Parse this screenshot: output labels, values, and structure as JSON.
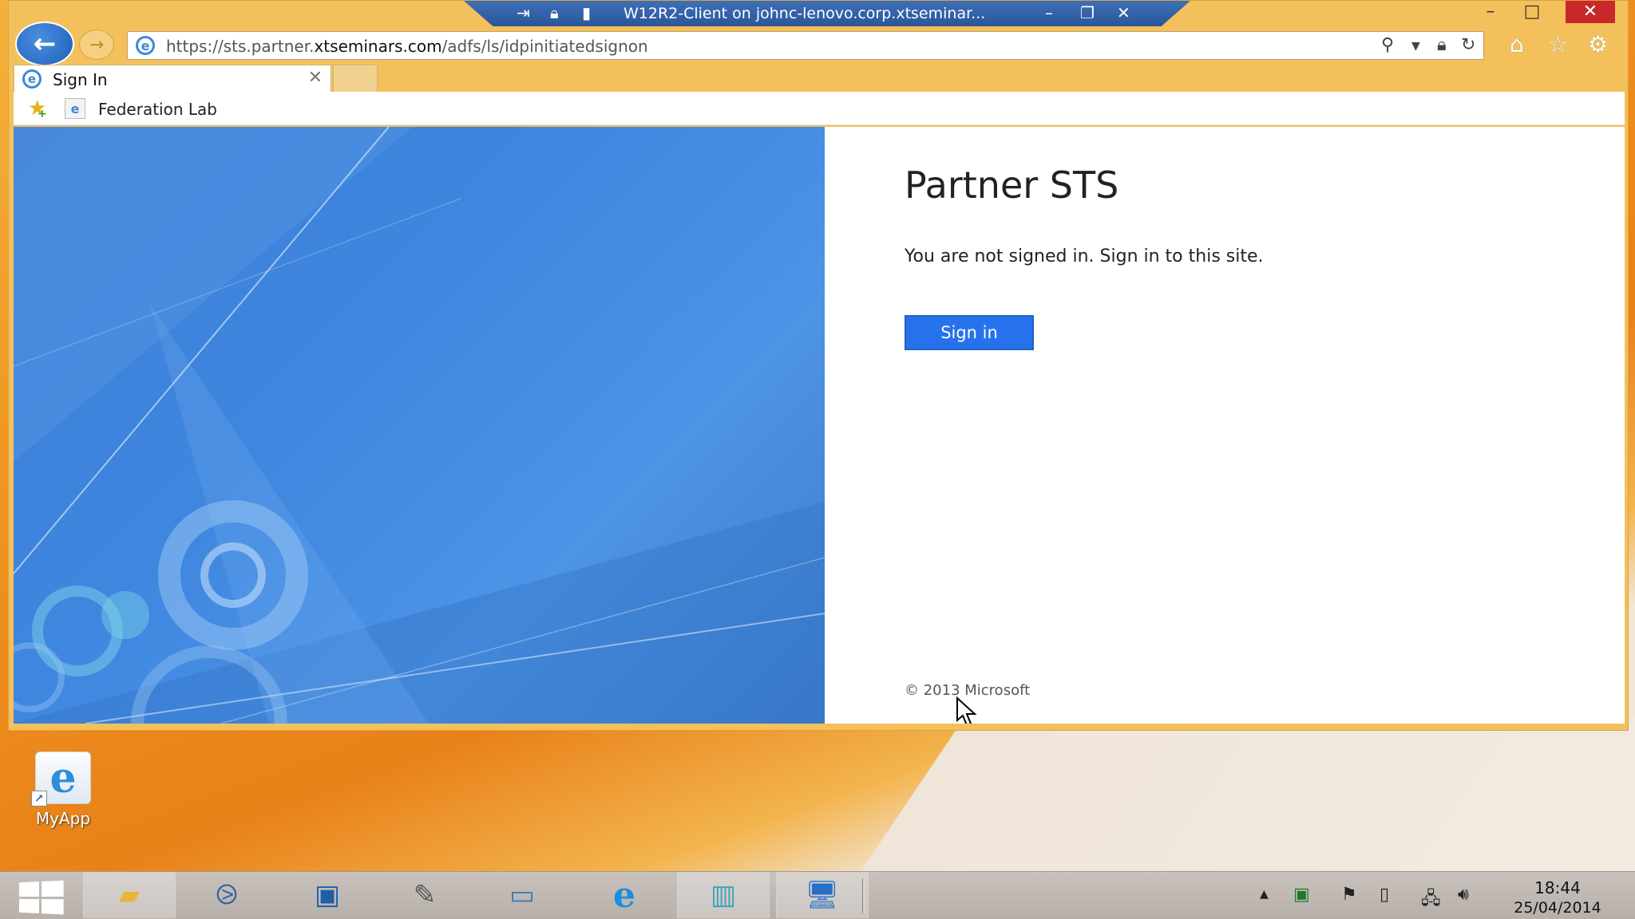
{
  "remote_session": {
    "title": "W12R2-Client on johnc-lenovo.corp.xtseminar...",
    "icons": {
      "pin": "pin-icon",
      "lock": "lock-icon",
      "signal": "signal-strength-icon",
      "minimize": "minimize-icon",
      "restore": "restore-icon",
      "close": "close-icon"
    }
  },
  "window_controls": {
    "minimize": "–",
    "maximize": "□",
    "close": "✕"
  },
  "navigation": {
    "back": "←",
    "forward": "→",
    "url_prefix": "https://sts.partner.",
    "url_domain": "xtseminars.com",
    "url_path": "/adfs/ls/idpinitiatedsignon",
    "tool_icons": [
      "search-icon",
      "dropdown-icon",
      "lock-icon",
      "refresh-icon"
    ],
    "command_icons": [
      "home-icon",
      "favorites-star-icon",
      "settings-gear-icon"
    ]
  },
  "tabs": [
    {
      "label": "Sign In",
      "active": true
    }
  ],
  "favorites": [
    {
      "label": "Federation Lab"
    }
  ],
  "page": {
    "title": "Partner STS",
    "message": "You are not signed in. Sign in to this site.",
    "signin_button": "Sign in",
    "copyright": "© 2013 Microsoft",
    "accent_color": "#2672ec",
    "illustration_color": "#4a90e2"
  },
  "desktop": {
    "icons": [
      {
        "label": "MyApp",
        "icon": "internet-explorer-icon"
      }
    ]
  },
  "taskbar": {
    "apps": [
      {
        "name": "file-explorer",
        "active": true
      },
      {
        "name": "powershell",
        "active": false
      },
      {
        "name": "server-manager",
        "active": false
      },
      {
        "name": "admin-tool",
        "active": false
      },
      {
        "name": "console",
        "active": false
      },
      {
        "name": "internet-explorer",
        "active": false
      },
      {
        "name": "cluster-manager",
        "active": true
      },
      {
        "name": "remote-desktop",
        "active": true
      }
    ],
    "clock_time": "18:44",
    "clock_date": "25/04/2014"
  }
}
